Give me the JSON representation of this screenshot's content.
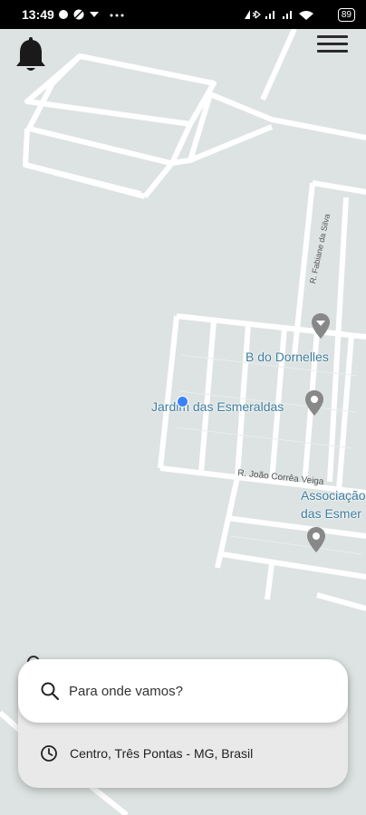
{
  "status_bar": {
    "time": "13:49",
    "left_icons": [
      "messenger-icon",
      "app-icon",
      "signal-app-icon",
      "more-icon"
    ],
    "right_icons": [
      "nfc-icon",
      "bluetooth-icon",
      "cell-signal-icon",
      "cell-signal-icon",
      "wifi-icon"
    ],
    "battery": "89"
  },
  "header": {
    "bell_icon": "bell-icon",
    "menu_icon": "hamburger-menu-icon"
  },
  "map": {
    "place_labels": [
      "B do Dornelles",
      "Jardim das Esmeraldas",
      "Associação",
      "das Esmer"
    ],
    "street_labels": [
      "R. Fabiane da Silva",
      "R. João Corrêa Veiga"
    ],
    "pin_icons": [
      "place-pin-icon",
      "place-pin-icon",
      "place-pin-icon"
    ]
  },
  "search": {
    "placeholder": "Para onde vamos?",
    "icon": "search-icon"
  },
  "recent": {
    "icon": "clock-icon",
    "label": "Centro, Três Pontas - MG, Brasil"
  }
}
